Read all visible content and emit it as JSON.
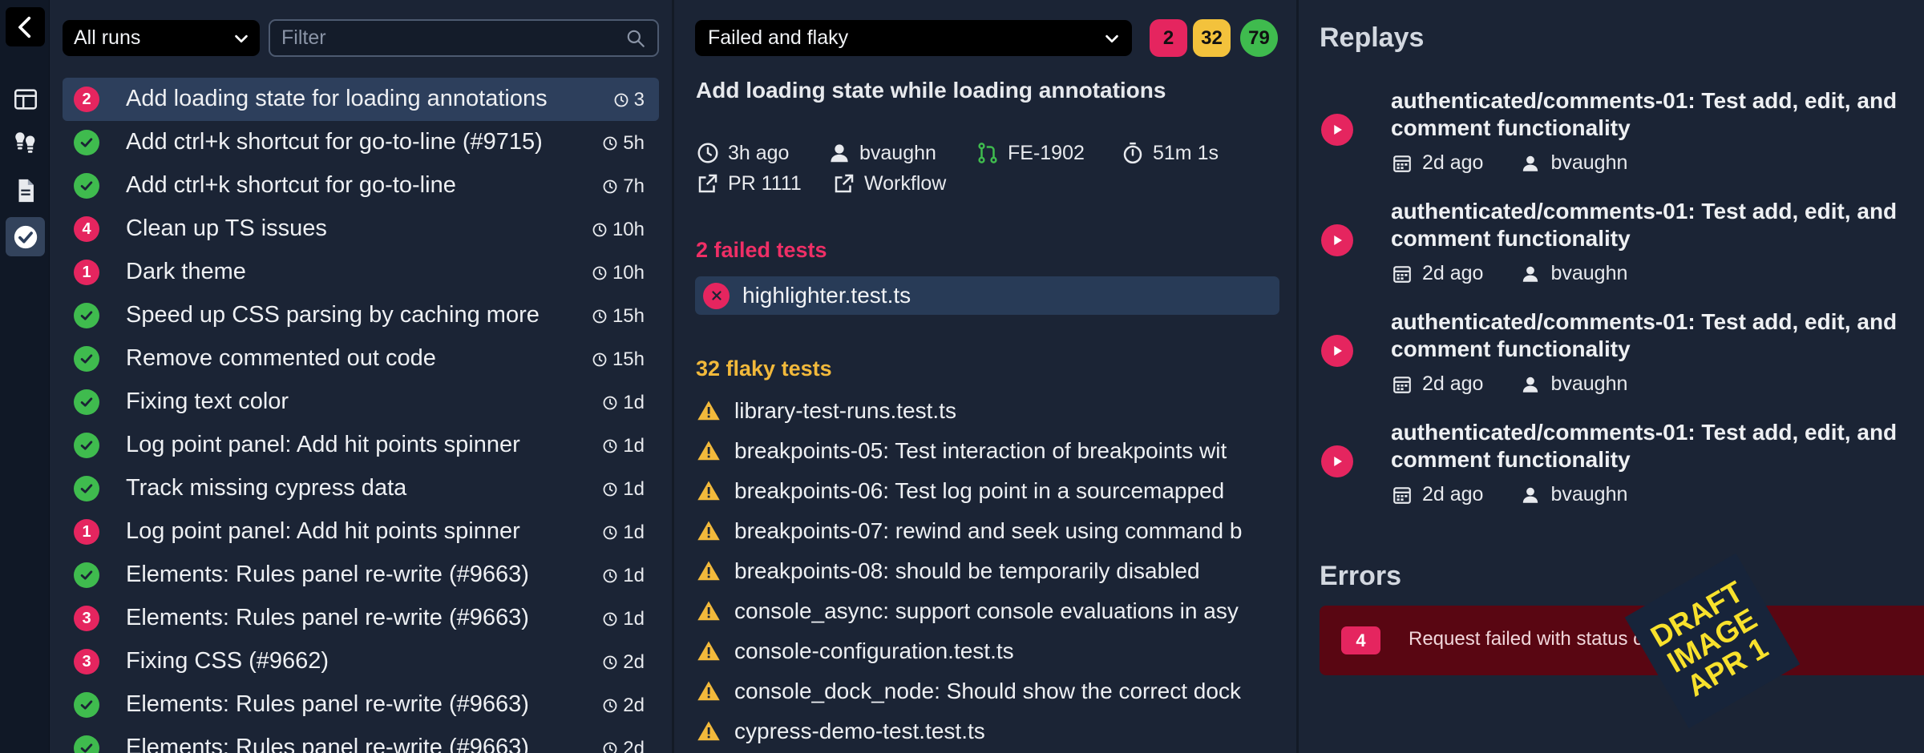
{
  "nav": {
    "back_icon": "chevron-left-icon",
    "items": [
      {
        "icon": "layout-icon"
      },
      {
        "icon": "lightbulbs-icon"
      },
      {
        "icon": "document-icon"
      },
      {
        "icon": "check-circle-icon",
        "active": true
      }
    ]
  },
  "runs_panel": {
    "filter_select": "All runs",
    "filter_placeholder": "Filter",
    "runs": [
      {
        "status": "fail",
        "count": "2",
        "title": "Add loading state for loading annotations",
        "time": "3",
        "selected": true
      },
      {
        "status": "pass",
        "count": "",
        "title": "Add ctrl+k shortcut for go-to-line (#9715)",
        "time": "5h"
      },
      {
        "status": "pass",
        "count": "",
        "title": "Add ctrl+k shortcut for go-to-line",
        "time": "7h"
      },
      {
        "status": "fail",
        "count": "4",
        "title": "Clean up TS issues",
        "time": "10h"
      },
      {
        "status": "fail",
        "count": "1",
        "title": "Dark theme",
        "time": "10h"
      },
      {
        "status": "pass",
        "count": "",
        "title": "Speed up CSS parsing by caching more",
        "time": "15h"
      },
      {
        "status": "pass",
        "count": "",
        "title": "Remove commented out code",
        "time": "15h"
      },
      {
        "status": "pass",
        "count": "",
        "title": "Fixing text color",
        "time": "1d"
      },
      {
        "status": "pass",
        "count": "",
        "title": "Log point panel: Add hit points spinner",
        "time": "1d"
      },
      {
        "status": "pass",
        "count": "",
        "title": "Track missing cypress data",
        "time": "1d"
      },
      {
        "status": "fail",
        "count": "1",
        "title": "Log point panel: Add hit points spinner",
        "time": "1d"
      },
      {
        "status": "pass",
        "count": "",
        "title": "Elements: Rules panel re-write (#9663)",
        "time": "1d"
      },
      {
        "status": "fail",
        "count": "3",
        "title": "Elements: Rules panel re-write (#9663)",
        "time": "1d"
      },
      {
        "status": "fail",
        "count": "3",
        "title": "Fixing CSS (#9662)",
        "time": "2d"
      },
      {
        "status": "pass",
        "count": "",
        "title": "Elements: Rules panel re-write (#9663)",
        "time": "2d"
      },
      {
        "status": "pass",
        "count": "",
        "title": "Elements: Rules panel re-write (#9663)",
        "time": "2d"
      }
    ]
  },
  "details": {
    "filter_select": "Failed and flaky",
    "counts": {
      "failed": "2",
      "flaky": "32",
      "passed": "79"
    },
    "title": "Add loading state while loading annotations",
    "meta": {
      "time": "3h ago",
      "user": "bvaughn",
      "branch": "FE-1902",
      "duration": "51m 1s",
      "pr": "PR 1111",
      "workflow": "Workflow"
    },
    "failed_heading": "2 failed tests",
    "failed_tests": [
      "highlighter.test.ts"
    ],
    "flaky_heading": "32 flaky tests",
    "flaky_tests": [
      "library-test-runs.test.ts",
      "breakpoints-05: Test interaction of breakpoints wit",
      "breakpoints-06: Test log point in a sourcemapped",
      "breakpoints-07: rewind and seek using command b",
      "breakpoints-08: should be temporarily disabled",
      "console_async: support console evaluations in asy",
      "console-configuration.test.ts",
      "console_dock_node: Should show the correct dock",
      "cypress-demo-test.test.ts"
    ]
  },
  "replays": {
    "heading": "Replays",
    "items": [
      {
        "title": "authenticated/comments-01: Test add, edit, and comment functionality",
        "date": "2d ago",
        "user": "bvaughn"
      },
      {
        "title": "authenticated/comments-01: Test add, edit, and comment functionality",
        "date": "2d ago",
        "user": "bvaughn"
      },
      {
        "title": "authenticated/comments-01: Test add, edit, and comment functionality",
        "date": "2d ago",
        "user": "bvaughn"
      },
      {
        "title": "authenticated/comments-01: Test add, edit, and comment functionality",
        "date": "2d ago",
        "user": "bvaughn"
      }
    ],
    "errors_heading": "Errors",
    "error": {
      "count": "4",
      "text": "Request failed with status co"
    }
  },
  "stamp": "DRAFT\nIMAGE\nAPR 1",
  "colors": {
    "fail": "#e5255f",
    "flaky": "#f2b93b",
    "pass": "#3fbb4e",
    "selected_row": "#2d3f5c"
  }
}
